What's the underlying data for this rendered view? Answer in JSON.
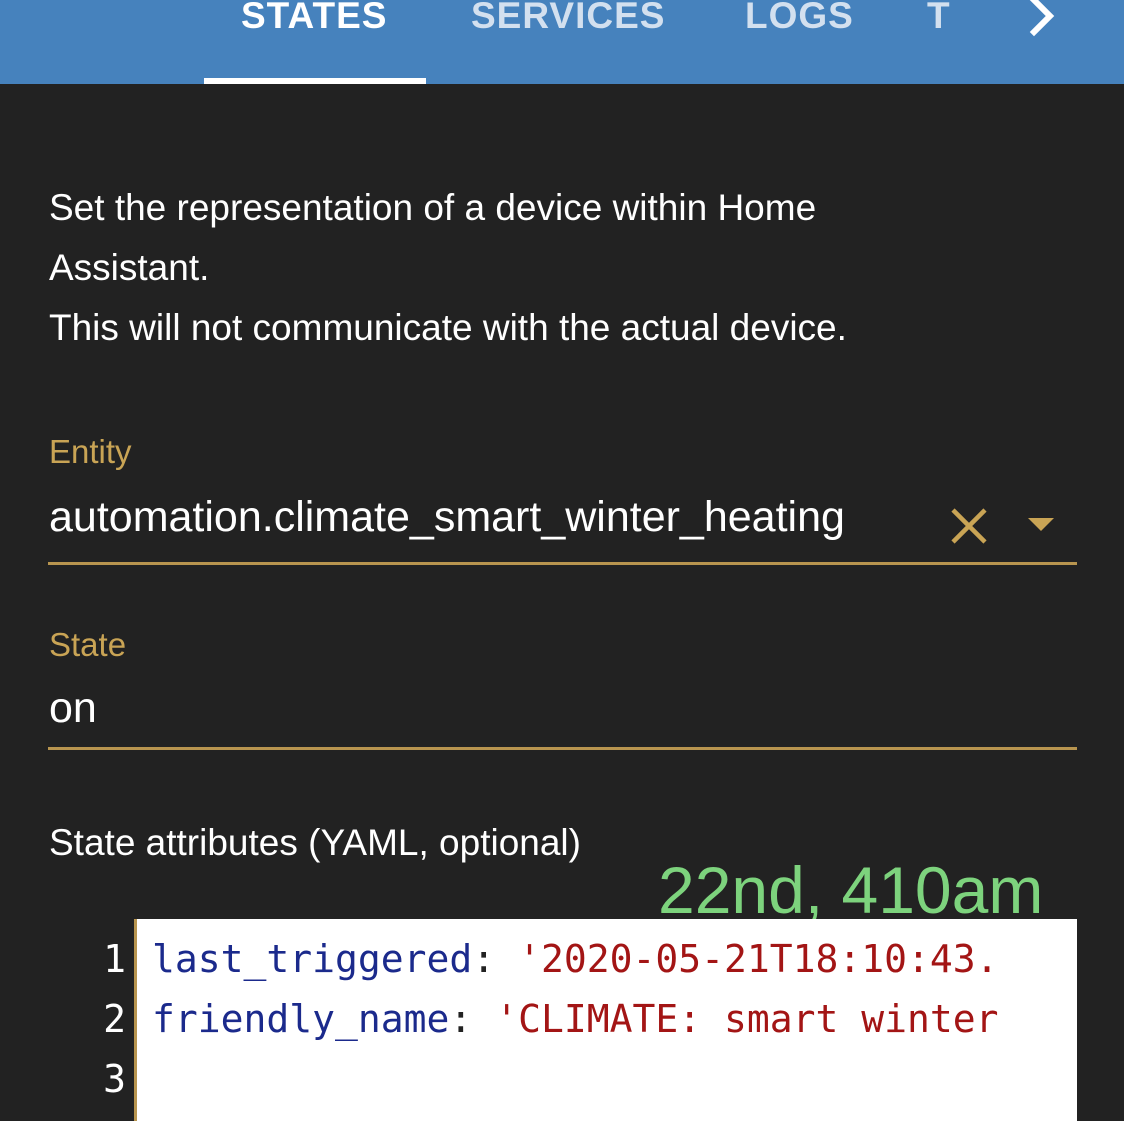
{
  "tabs": [
    {
      "label": "STATES",
      "active": true
    },
    {
      "label": "SERVICES",
      "active": false
    },
    {
      "label": "LOGS",
      "active": false
    },
    {
      "label": "T",
      "active": false
    }
  ],
  "description": {
    "line1": "Set the representation of a device within Home",
    "line2": "Assistant.",
    "line3": "This will not communicate with the actual device."
  },
  "entity": {
    "label": "Entity",
    "value": "automation.climate_smart_winter_heating"
  },
  "state": {
    "label": "State",
    "value": "on"
  },
  "attributes": {
    "label": "State attributes (YAML, optional)",
    "line_numbers": [
      "1",
      "2",
      "3"
    ],
    "lines": [
      {
        "key": "last_triggered",
        "sep": ": ",
        "value": "'2020-05-21T18:10:43."
      },
      {
        "key": "friendly_name",
        "sep": ": ",
        "value": "'CLIMATE: smart winter"
      }
    ]
  },
  "overlay_note": "22nd, 410am",
  "colors": {
    "header": "#4682bd",
    "background": "#222222",
    "accent": "#c9a455",
    "note": "#7dd37d"
  },
  "icons": {
    "clear": "close-icon",
    "dropdown": "caret-down-icon",
    "tab_scroll": "chevron-right-icon"
  }
}
